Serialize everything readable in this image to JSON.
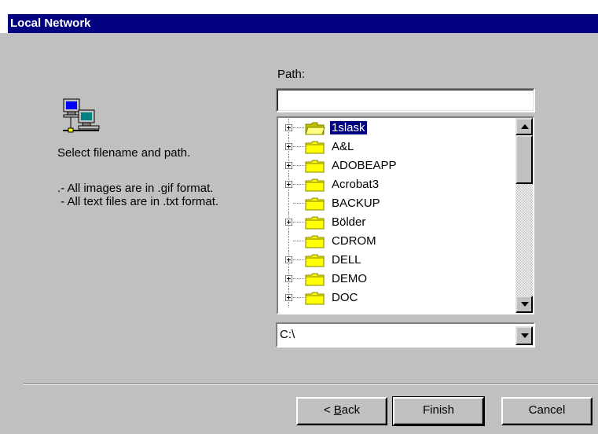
{
  "window": {
    "title": "Local Network"
  },
  "left_panel": {
    "instruction": "Select filename and path.",
    "note_line1": ".- All images are in .gif format.",
    "note_line2": " - All text files are in .txt format."
  },
  "path": {
    "label": "Path:",
    "value": ""
  },
  "tree": {
    "items": [
      {
        "label": "1slask",
        "expandable": true,
        "selected": true
      },
      {
        "label": "A&L",
        "expandable": true,
        "selected": false
      },
      {
        "label": "ADOBEAPP",
        "expandable": true,
        "selected": false
      },
      {
        "label": "Acrobat3",
        "expandable": true,
        "selected": false
      },
      {
        "label": "BACKUP",
        "expandable": false,
        "selected": false
      },
      {
        "label": "Bölder",
        "expandable": true,
        "selected": false
      },
      {
        "label": "CDROM",
        "expandable": false,
        "selected": false
      },
      {
        "label": "DELL",
        "expandable": true,
        "selected": false
      },
      {
        "label": "DEMO",
        "expandable": true,
        "selected": false
      },
      {
        "label": "DOC",
        "expandable": true,
        "selected": false
      }
    ]
  },
  "drive": {
    "selected": "C:\\"
  },
  "buttons": {
    "back_prefix": "< ",
    "back_accel": "B",
    "back_rest": "ack",
    "finish": "Finish",
    "cancel": "Cancel"
  },
  "icons": {
    "network": "network-computers-icon",
    "folder": "folder-icon",
    "open_folder": "open-folder-icon"
  },
  "colors": {
    "title_bar": "#000080",
    "face": "#c0c0c0",
    "selection": "#000080",
    "folder": "#ffff00"
  }
}
